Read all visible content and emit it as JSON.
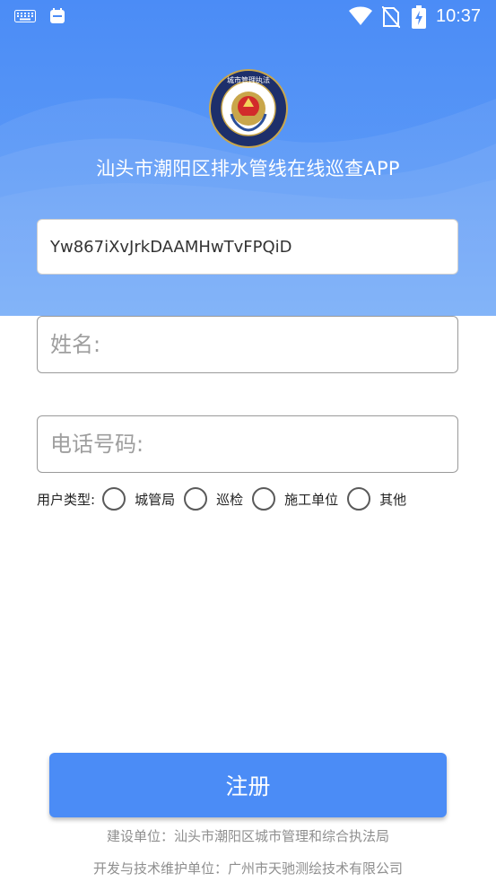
{
  "status_bar": {
    "time": "10:37",
    "icons": [
      "keyboard-icon",
      "notification-icon",
      "wifi-icon",
      "no-sim-icon",
      "battery-charging-icon"
    ]
  },
  "header": {
    "emblem_text": "城市管理执法 URBAN MANAGEMENT AND LAW ENFORCEMENT",
    "app_title": "汕头市潮阳区排水管线在线巡查APP"
  },
  "form": {
    "key_value": "Yw867iXvJrkDAAMHwTvFPQiD",
    "name_placeholder": "姓名:",
    "phone_placeholder": "电话号码:",
    "user_type_label": "用户类型:",
    "user_type_options": [
      "城管局",
      "巡检",
      "施工单位",
      "其他"
    ]
  },
  "register_button": "注册",
  "footer": {
    "builder": "建设单位：汕头市潮阳区城市管理和综合执法局",
    "developer": "开发与技术维护单位：广州市天驰测绘技术有限公司"
  },
  "colors": {
    "primary": "#4b8cf6",
    "footer_text": "#8e8e8e"
  }
}
